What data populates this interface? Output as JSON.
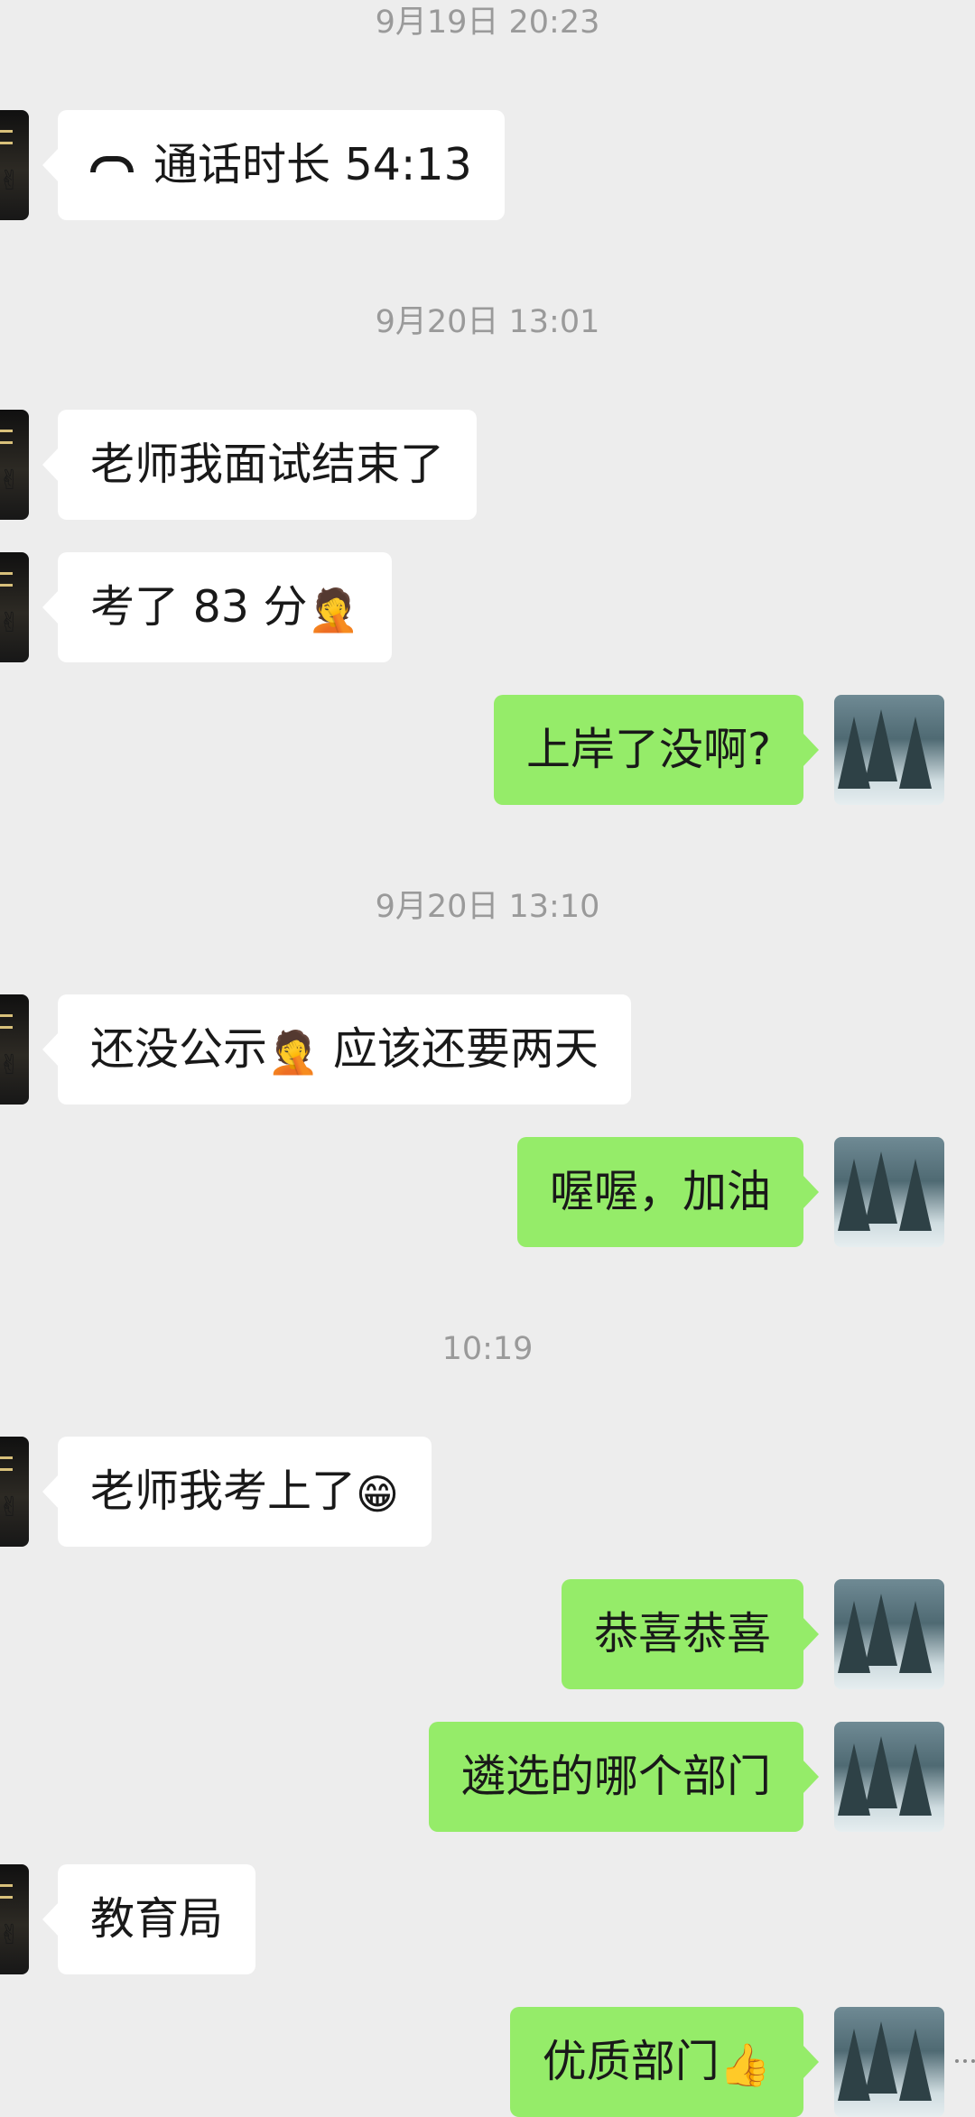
{
  "chat": {
    "ts1": "9月19日 20:23",
    "call_text": "通话时长 54:13",
    "ts2": "9月20日 13:01",
    "msg1": "老师我面试结束了",
    "msg2_text": "考了 83 分",
    "msg2_emoji": "🤦",
    "msg3": "上岸了没啊?",
    "ts3": "9月20日 13:10",
    "msg4_part1": "还没公示",
    "msg4_emoji": "🤦",
    "msg4_part2": " 应该还要两天",
    "msg5": "喔喔，加油",
    "ts4": "10:19",
    "msg6_text": "老师我考上了",
    "msg6_emoji": "😁",
    "msg7": "恭喜恭喜",
    "msg8": "遴选的哪个部门",
    "msg9": "教育局",
    "msg10_text": "优质部门",
    "msg10_emoji": "👍"
  },
  "colors": {
    "background": "#ededed",
    "incoming_bubble": "#ffffff",
    "outgoing_bubble": "#95ec69",
    "timestamp_text": "#9a9a9a"
  },
  "icons": {
    "call": "phone-hangup-icon",
    "left_avatar_hand": "victory-hand",
    "right_avatar": "snowy-forest-photo"
  }
}
